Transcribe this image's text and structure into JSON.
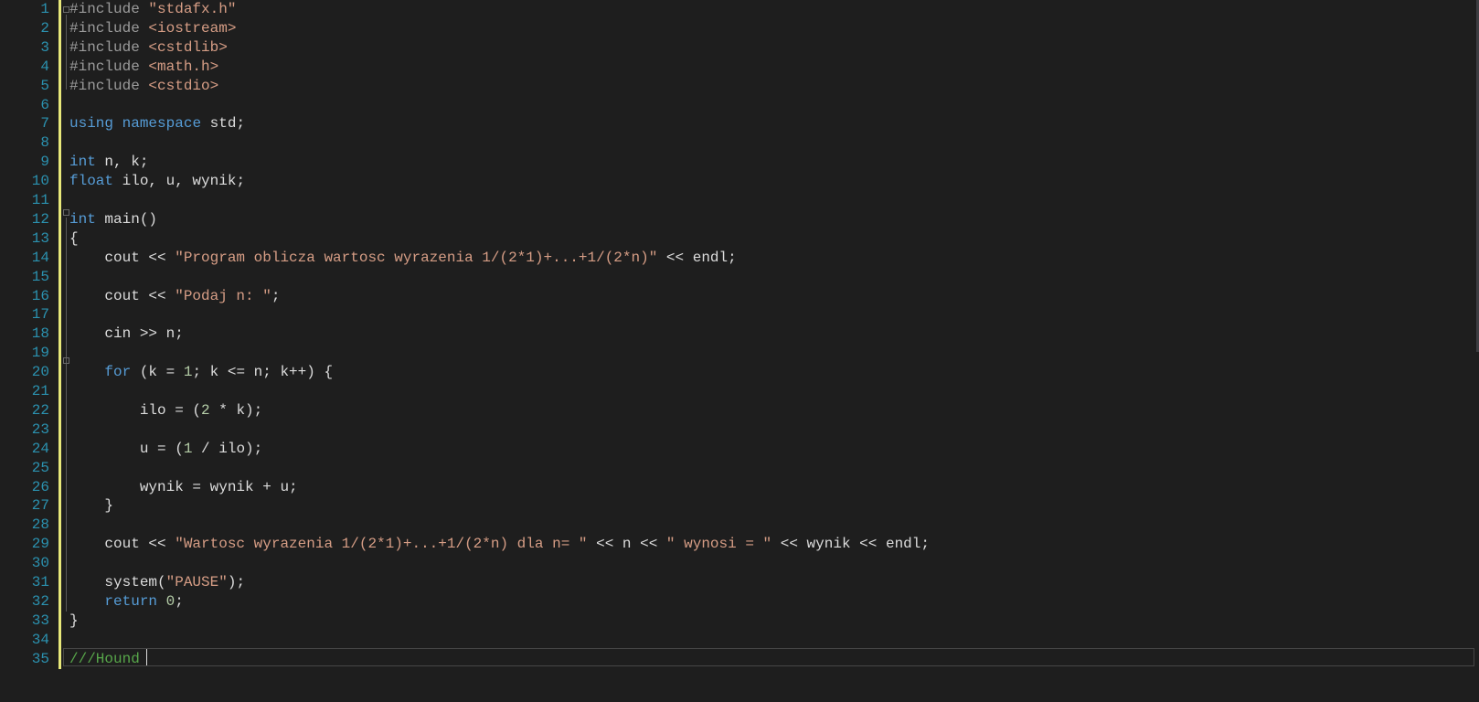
{
  "line_numbers": [
    "1",
    "2",
    "3",
    "4",
    "5",
    "6",
    "7",
    "8",
    "9",
    "10",
    "11",
    "12",
    "13",
    "14",
    "15",
    "16",
    "17",
    "18",
    "19",
    "20",
    "21",
    "22",
    "23",
    "24",
    "25",
    "26",
    "27",
    "28",
    "29",
    "30",
    "31",
    "32",
    "33",
    "34",
    "35"
  ],
  "code": [
    [
      {
        "t": "p",
        "v": "#include "
      },
      {
        "t": "s",
        "v": "\"stdafx.h\""
      }
    ],
    [
      {
        "t": "p",
        "v": "#include "
      },
      {
        "t": "s",
        "v": "<iostream>"
      }
    ],
    [
      {
        "t": "p",
        "v": "#include "
      },
      {
        "t": "s",
        "v": "<cstdlib>"
      }
    ],
    [
      {
        "t": "p",
        "v": "#include "
      },
      {
        "t": "s",
        "v": "<math.h>"
      }
    ],
    [
      {
        "t": "p",
        "v": "#include "
      },
      {
        "t": "s",
        "v": "<cstdio>"
      }
    ],
    [],
    [
      {
        "t": "k",
        "v": "using"
      },
      {
        "t": "t",
        "v": " "
      },
      {
        "t": "k",
        "v": "namespace"
      },
      {
        "t": "t",
        "v": " std;"
      }
    ],
    [],
    [
      {
        "t": "k",
        "v": "int"
      },
      {
        "t": "t",
        "v": " n, k;"
      }
    ],
    [
      {
        "t": "k",
        "v": "float"
      },
      {
        "t": "t",
        "v": " ilo, u, wynik;"
      }
    ],
    [],
    [
      {
        "t": "k",
        "v": "int"
      },
      {
        "t": "t",
        "v": " main()"
      }
    ],
    [
      {
        "t": "t",
        "v": "{"
      }
    ],
    [
      {
        "t": "t",
        "v": "    cout << "
      },
      {
        "t": "s",
        "v": "\"Program oblicza wartosc wyrazenia 1/(2*1)+...+1/(2*n)\""
      },
      {
        "t": "t",
        "v": " << endl;"
      }
    ],
    [],
    [
      {
        "t": "t",
        "v": "    cout << "
      },
      {
        "t": "s",
        "v": "\"Podaj n: \""
      },
      {
        "t": "t",
        "v": ";"
      }
    ],
    [],
    [
      {
        "t": "t",
        "v": "    cin >> n;"
      }
    ],
    [],
    [
      {
        "t": "t",
        "v": "    "
      },
      {
        "t": "k",
        "v": "for"
      },
      {
        "t": "t",
        "v": " (k = "
      },
      {
        "t": "n",
        "v": "1"
      },
      {
        "t": "t",
        "v": "; k <= n; k++) {"
      }
    ],
    [],
    [
      {
        "t": "t",
        "v": "        ilo = ("
      },
      {
        "t": "n",
        "v": "2"
      },
      {
        "t": "t",
        "v": " * k);"
      }
    ],
    [],
    [
      {
        "t": "t",
        "v": "        u = ("
      },
      {
        "t": "n",
        "v": "1"
      },
      {
        "t": "t",
        "v": " / ilo);"
      }
    ],
    [],
    [
      {
        "t": "t",
        "v": "        wynik = wynik + u;"
      }
    ],
    [
      {
        "t": "t",
        "v": "    }"
      }
    ],
    [],
    [
      {
        "t": "t",
        "v": "    cout << "
      },
      {
        "t": "s",
        "v": "\"Wartosc wyrazenia 1/(2*1)+...+1/(2*n) dla n= \""
      },
      {
        "t": "t",
        "v": " << n << "
      },
      {
        "t": "s",
        "v": "\" wynosi = \""
      },
      {
        "t": "t",
        "v": " << wynik << endl;"
      }
    ],
    [],
    [
      {
        "t": "t",
        "v": "    system("
      },
      {
        "t": "s",
        "v": "\"PAUSE\""
      },
      {
        "t": "t",
        "v": ");"
      }
    ],
    [
      {
        "t": "t",
        "v": "    "
      },
      {
        "t": "k",
        "v": "return"
      },
      {
        "t": "t",
        "v": " "
      },
      {
        "t": "n",
        "v": "0"
      },
      {
        "t": "t",
        "v": ";"
      }
    ],
    [
      {
        "t": "t",
        "v": "}"
      }
    ],
    [],
    [
      {
        "t": "c",
        "v": "///Hound"
      }
    ]
  ],
  "colors": {
    "background": "#1e1e1e",
    "line_number": "#2b91af",
    "keyword": "#569cd6",
    "string": "#d69d85",
    "number": "#b5cea8",
    "preprocessor": "#9b9b9b",
    "comment": "#57a64a",
    "text": "#dcdcdc",
    "change_bar": "#e8e87a"
  },
  "icons": {
    "collapse_marker": "minus-box-icon"
  }
}
